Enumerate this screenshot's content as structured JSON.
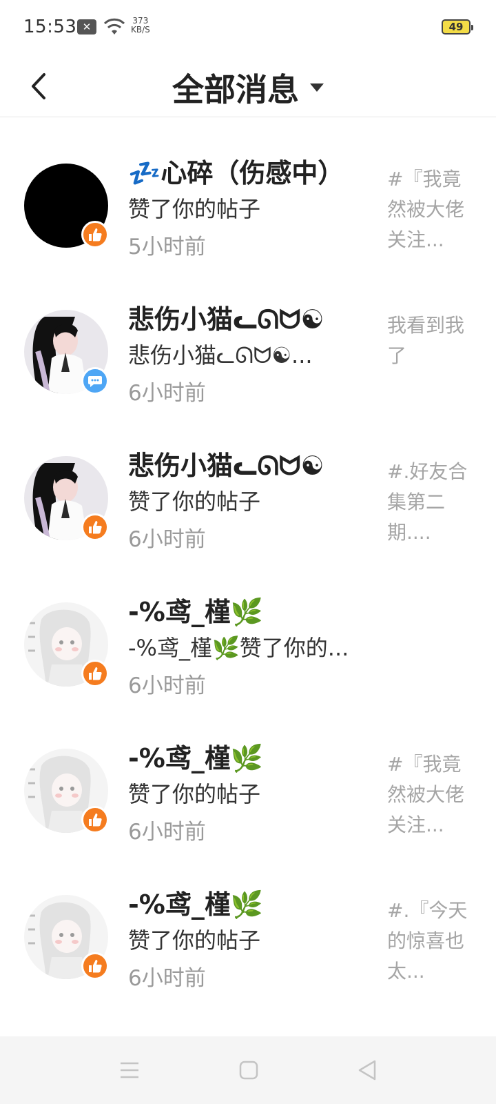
{
  "status_bar": {
    "time": "15:53",
    "notification_icon": "x-icon",
    "speed_value": "373",
    "speed_unit": "KB/S",
    "battery": "49"
  },
  "header": {
    "title": "全部消息",
    "back_icon": "chevron-left-icon",
    "dropdown_icon": "caret-down-icon"
  },
  "messages": [
    {
      "name": "💤心碎（伤感中）",
      "action": "赞了你的帖子",
      "time": "5小时前",
      "preview": "#『我竟然被大佬关注...",
      "badge": "like"
    },
    {
      "name": "悲伤小猫ᓚᘏᗢ☯",
      "action": "悲伤小猫ᓚᘏᗢ☯...",
      "time": "6小时前",
      "preview": "我看到我了",
      "badge": "comment"
    },
    {
      "name": "悲伤小猫ᓚᘏᗢ☯",
      "action": "赞了你的帖子",
      "time": "6小时前",
      "preview": "#.好友合集第二期....",
      "badge": "like"
    },
    {
      "name": "-%鸢_槿🌿",
      "action": "-%鸢_槿🌿赞了你的...",
      "time": "6小时前",
      "preview": "",
      "badge": "like"
    },
    {
      "name": "-%鸢_槿🌿",
      "action": "赞了你的帖子",
      "time": "6小时前",
      "preview": "#『我竟然被大佬关注...",
      "badge": "like"
    },
    {
      "name": "-%鸢_槿🌿",
      "action": "赞了你的帖子",
      "time": "6小时前",
      "preview": "#.『今天的惊喜也太...",
      "badge": "like"
    }
  ],
  "colors": {
    "like_badge": "#f57c1f",
    "comment_badge": "#4ea6f5",
    "nav_background": "#f5f5f5"
  },
  "nav_bar": {
    "menu_icon": "menu-icon",
    "home_icon": "square-icon",
    "back_icon": "triangle-back-icon"
  }
}
